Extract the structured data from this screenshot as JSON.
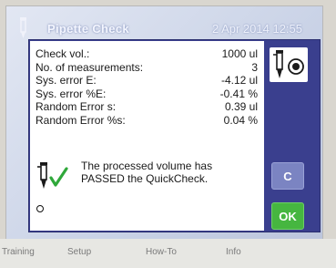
{
  "window": {
    "title": "Pipette Check",
    "datetime": "2 Apr 2014  12:55"
  },
  "results": [
    {
      "label": "Check vol.:",
      "value": "1000 ul"
    },
    {
      "label": "No. of measurements:",
      "value": "3"
    },
    {
      "label": "Sys. error E:",
      "value": "-4.12 ul"
    },
    {
      "label": "Sys. error %E:",
      "value": "-0.41 %"
    },
    {
      "label": "Random Error s:",
      "value": "0.39 ul"
    },
    {
      "label": "Random Error %s:",
      "value": "0.04 %"
    }
  ],
  "status": {
    "line1": "The processed volume has",
    "line2": "PASSED the QuickCheck."
  },
  "buttons": {
    "cancel": "C",
    "ok": "OK"
  },
  "tabs": [
    "Training",
    "Setup",
    "How-To",
    "Info"
  ],
  "icons": {
    "title": "pipette-icon",
    "side": "pipette-check-icon",
    "pass": "check-icon",
    "bottom": "circle-icon"
  },
  "colors": {
    "dialog": "#3a3f8e",
    "ok_button": "#46b640",
    "cancel_button": "#7b84c2",
    "check": "#2fa83a"
  }
}
